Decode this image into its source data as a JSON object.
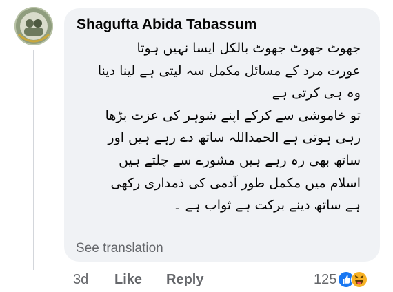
{
  "comment": {
    "author": "Shagufta Abida Tabassum",
    "body_lines": [
      "جھوٹ جھوٹ جھوٹ بالکل ایسا نہیں ہوتا",
      "عورت مرد کے مسائل مکمل سہ لیتی ہے لینا دینا",
      "وہ ہی کرتی ہے",
      "تو خاموشی سے کرکے اپنے شوہر کی عزت بڑھا",
      "رہی ہوتی ہے الحمداللہ ساتھ دے رہے ہیں اور",
      "ساتھ بھی رہ رہے ہیں مشورے سے چلتے ہیں",
      "اسلام میں مکمل طور آدمی کی ذمداری رکھی",
      "ہے ساتھ دینے برکت ہے ثواب ہے ۔"
    ],
    "see_translation": "See translation",
    "timestamp": "3d",
    "like_label": "Like",
    "reply_label": "Reply",
    "reaction_count": "125",
    "reaction_icons": [
      "like-icon",
      "haha-icon"
    ]
  },
  "colors": {
    "bubble": "#f0f2f5",
    "text": "#050505",
    "secondary": "#65676b",
    "like_blue": "#1877f2",
    "haha_yellow": "#f7b125"
  }
}
